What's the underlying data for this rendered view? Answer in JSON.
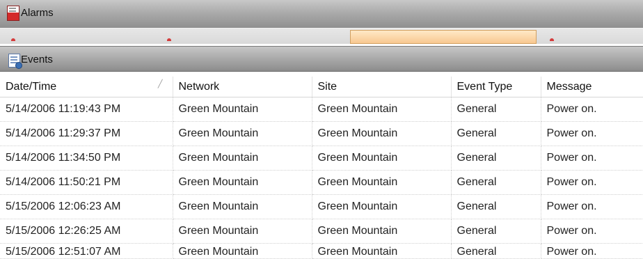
{
  "alarms_panel": {
    "title": "Alarms"
  },
  "events_panel": {
    "title": "Events",
    "columns": [
      {
        "label": "Date/Time",
        "sorted": true
      },
      {
        "label": "Network"
      },
      {
        "label": "Site"
      },
      {
        "label": "Event Type"
      },
      {
        "label": "Message"
      }
    ],
    "rows": [
      [
        "5/14/2006 11:19:43 PM",
        "Green Mountain",
        "Green Mountain",
        "General",
        "Power on."
      ],
      [
        "5/14/2006 11:29:37 PM",
        "Green Mountain",
        "Green Mountain",
        "General",
        "Power on."
      ],
      [
        "5/14/2006 11:34:50 PM",
        "Green Mountain",
        "Green Mountain",
        "General",
        "Power on."
      ],
      [
        "5/14/2006 11:50:21 PM",
        "Green Mountain",
        "Green Mountain",
        "General",
        "Power on."
      ],
      [
        "5/15/2006 12:06:23 AM",
        "Green Mountain",
        "Green Mountain",
        "General",
        "Power on."
      ],
      [
        "5/15/2006 12:26:25 AM",
        "Green Mountain",
        "Green Mountain",
        "General",
        "Power on."
      ],
      [
        "5/15/2006 12:51:07 AM",
        "Green Mountain",
        "Green Mountain",
        "General",
        "Power on."
      ]
    ]
  },
  "icons": {
    "alarms": "alarm-document-icon",
    "events": "events-document-icon",
    "sort": "sort-ascending-icon"
  }
}
